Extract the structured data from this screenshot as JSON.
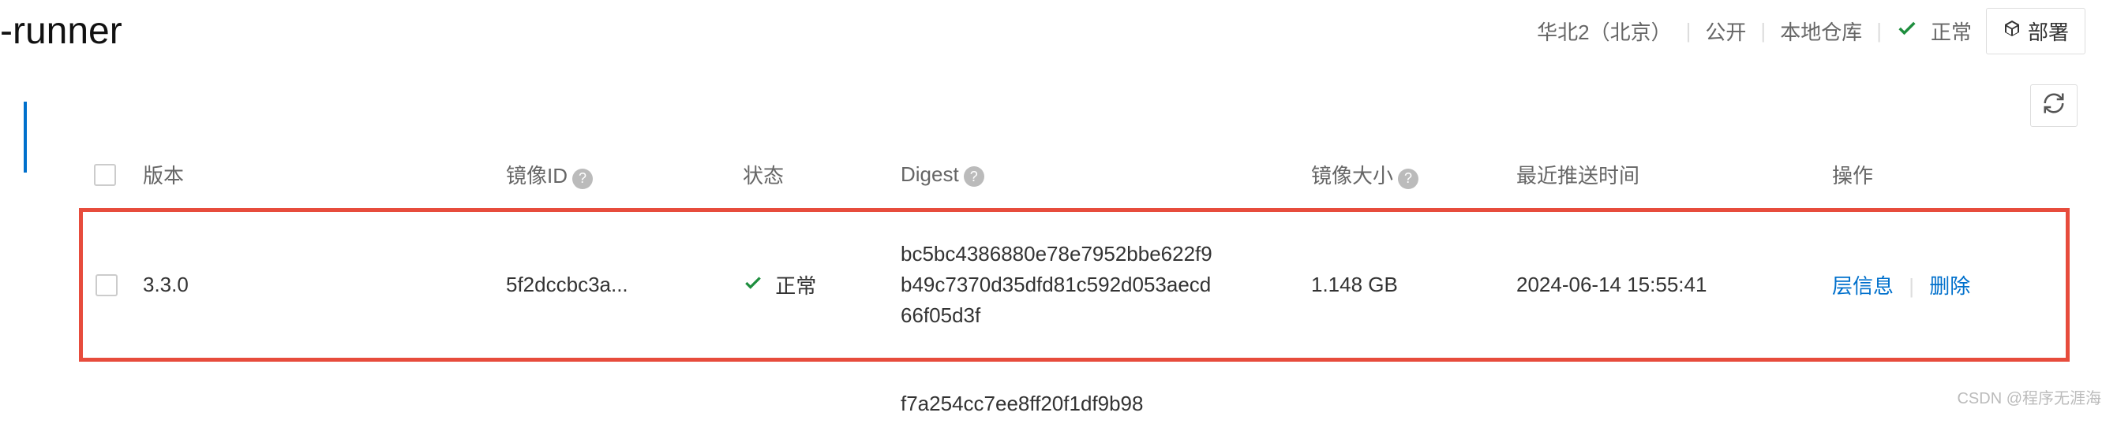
{
  "header": {
    "title": "-runner",
    "region": "华北2（北京）",
    "visibility": "公开",
    "repo_type": "本地仓库",
    "status": "正常",
    "deploy_label": "部署"
  },
  "table": {
    "headers": {
      "version": "版本",
      "image_id": "镜像ID",
      "status": "状态",
      "digest": "Digest",
      "size": "镜像大小",
      "push_time": "最近推送时间",
      "actions": "操作"
    },
    "rows": [
      {
        "version": "3.3.0",
        "image_id": "5f2dccbc3a...",
        "status": "正常",
        "digest": "bc5bc4386880e78e7952bbe622f9b49c7370d35dfd81c592d053aecd66f05d3f",
        "size": "1.148 GB",
        "push_time": "2024-06-14 15:55:41",
        "action_layer": "层信息",
        "action_delete": "删除"
      }
    ],
    "extra_digest": "f7a254cc7ee8ff20f1df9b98"
  },
  "watermark": "CSDN @程序无涯海"
}
